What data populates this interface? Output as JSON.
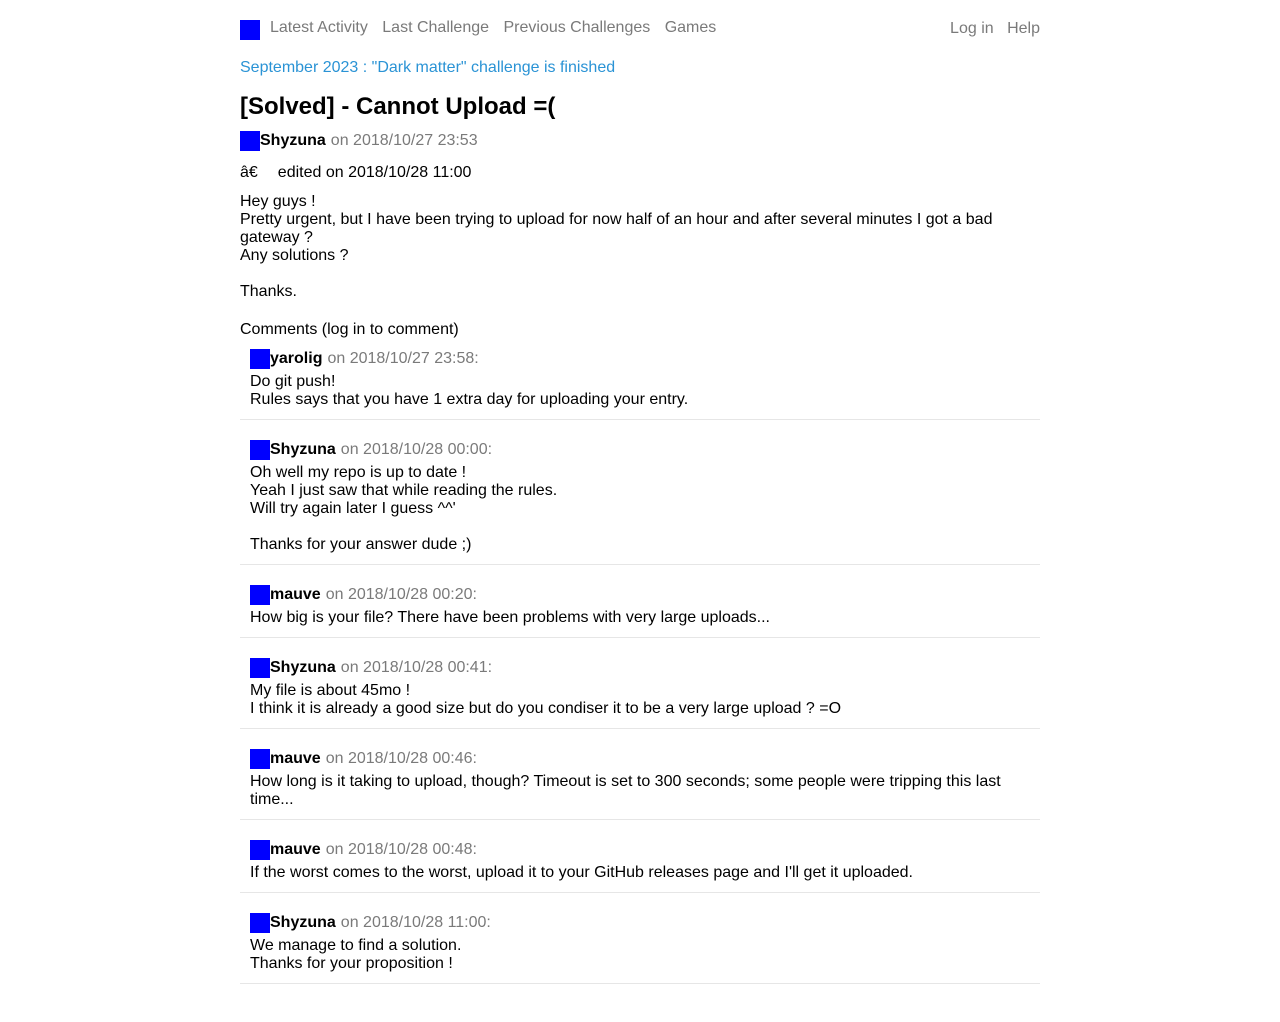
{
  "nav": {
    "links": [
      "Latest Activity",
      "Last Challenge",
      "Previous Challenges",
      "Games"
    ],
    "right": [
      "Log in",
      "Help"
    ]
  },
  "announcement": "September 2023 : \"Dark matter\" challenge is finished",
  "post": {
    "title": "[Solved] - Cannot Upload =(",
    "author": "Shyzuna",
    "date": "on 2018/10/27 23:53",
    "edited_glyph": "â€",
    "edited": "edited on 2018/10/28 11:00",
    "body": [
      "Hey guys !",
      "Pretty urgent, but I have been trying to upload for now half of an hour and after several minutes I got a bad gateway ?",
      "Any solutions ?",
      "",
      "Thanks."
    ]
  },
  "comments_header": "Comments (log in to comment)",
  "comments": [
    {
      "author": "yarolig",
      "date": "on 2018/10/27 23:58:",
      "lines": [
        "Do git push!",
        "Rules says that you have 1 extra day for uploading your entry."
      ]
    },
    {
      "author": "Shyzuna",
      "date": "on 2018/10/28 00:00:",
      "lines": [
        "Oh well my repo is up to date !",
        "Yeah I just saw that while reading the rules.",
        "Will try again later I guess ^^'",
        "",
        "Thanks for your answer dude ;)"
      ]
    },
    {
      "author": "mauve",
      "date": "on 2018/10/28 00:20:",
      "lines": [
        "How big is your file? There have been problems with very large uploads..."
      ]
    },
    {
      "author": "Shyzuna",
      "date": "on 2018/10/28 00:41:",
      "lines": [
        "My file is about 45mo !",
        "I think it is already a good size but do you condiser it to be a very large upload ? =O"
      ]
    },
    {
      "author": "mauve",
      "date": "on 2018/10/28 00:46:",
      "lines": [
        "How long is it taking to upload, though? Timeout is set to 300 seconds; some people were tripping this last time..."
      ]
    },
    {
      "author": "mauve",
      "date": "on 2018/10/28 00:48:",
      "lines": [
        "If the worst comes to the worst, upload it to your GitHub releases page and I'll get it uploaded."
      ]
    },
    {
      "author": "Shyzuna",
      "date": "on 2018/10/28 11:00:",
      "lines": [
        "We manage to find a solution.",
        "Thanks for your proposition !"
      ]
    }
  ]
}
